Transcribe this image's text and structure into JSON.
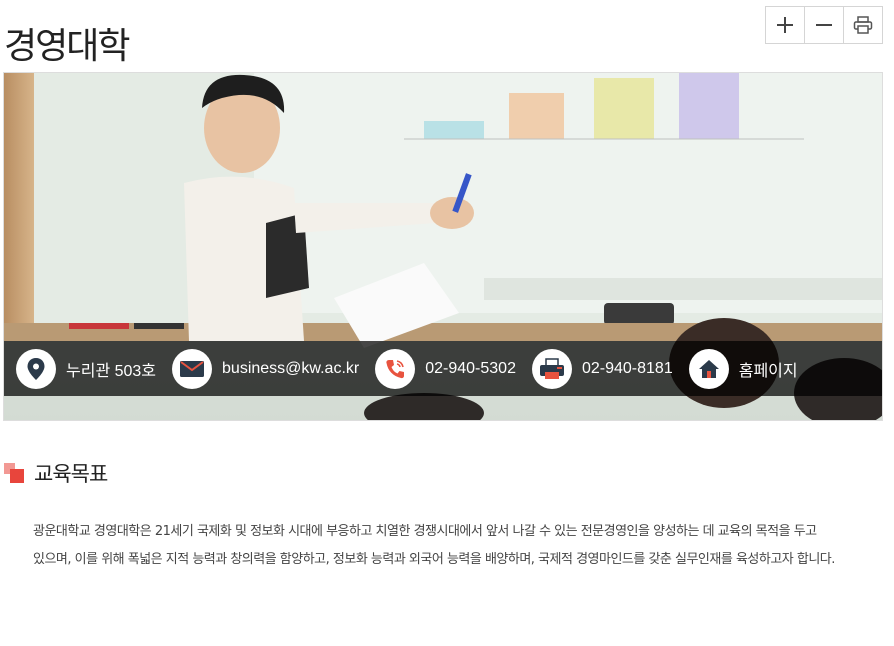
{
  "page": {
    "title": "경영대학"
  },
  "toolbar": {
    "zoom_in_icon": "plus-icon",
    "zoom_out_icon": "minus-icon",
    "print_icon": "printer-icon"
  },
  "info": {
    "location": "누리관 503호",
    "email": "business@kw.ac.kr",
    "phone": "02-940-5302",
    "fax": "02-940-8181",
    "homepage": "홈페이지",
    "icon_color": "#2b3a4a",
    "accent_color": "#e8533f"
  },
  "section": {
    "title": "교육목표",
    "line1": "광운대학교 경영대학은 21세기 국제화 및 정보화 시대에 부응하고 치열한 경쟁시대에서 앞서 나갈 수 있는 전문경영인을 양성하는 데 교육의 목적을 두고",
    "line2": "있으며, 이를 위해 폭넓은 지적 능력과 창의력을 함양하고, 정보화 능력과 외국어 능력을 배양하며, 국제적 경영마인드를 갖춘 실무인재를 육성하고자 합니다.",
    "accent_color": "#e8453c"
  }
}
